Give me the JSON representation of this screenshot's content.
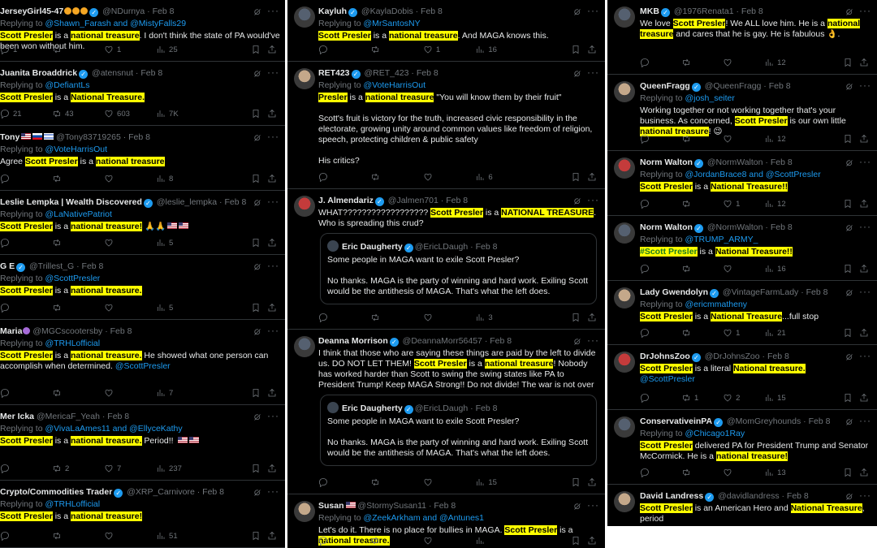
{
  "col1": [
    {
      "name": "JerseyGirl45-47",
      "handle": "@NDurnya",
      "date": "Feb 8",
      "replying": "Replying to",
      "mentions": "@Shawn_Farash and @MistyFalls29",
      "segments": [
        [
          "Scott Presler",
          "hlb"
        ],
        [
          " is a ",
          ""
        ],
        [
          "national treasure",
          "hlb"
        ],
        [
          ". I don't think the state of PA would've been won without him.",
          ""
        ]
      ],
      "stats": [
        "1",
        "",
        "1",
        "25"
      ]
    },
    {
      "name": "Juanita Broaddrick",
      "handle": "@atensnut",
      "date": "Feb 8",
      "replying": "Replying to",
      "mentions": "@DefiantLs",
      "segments": [
        [
          "Scott Presler",
          "hlb"
        ],
        [
          " is a ",
          ""
        ],
        [
          "National Treasure.",
          "hlb"
        ]
      ],
      "stats": [
        "21",
        "43",
        "603",
        "7K"
      ]
    },
    {
      "name": "Tony",
      "handle": "@Tony83719265",
      "date": "Feb 8",
      "replying": "Replying to",
      "mentions": "@VoteHarrisOut",
      "segments": [
        [
          "Agree ",
          ""
        ],
        [
          "Scott Presler",
          "hlb"
        ],
        [
          " is a ",
          ""
        ],
        [
          "national treasure",
          "hlb"
        ]
      ],
      "stats": [
        "",
        "",
        "",
        "8"
      ]
    },
    {
      "name": "Leslie Lempka | Wealth Discovered",
      "handle": "@leslie_lempka",
      "date": "Feb 8",
      "replying": "Replying to",
      "mentions": "@LaNativePatriot",
      "segments": [
        [
          "Scott Presler",
          "hlb"
        ],
        [
          " is a ",
          ""
        ],
        [
          "national treasure!",
          "hlb"
        ],
        [
          " 🙏🙏",
          ""
        ]
      ],
      "stats": [
        "",
        "",
        "",
        "5"
      ]
    },
    {
      "name": "G E",
      "handle": "@Trillest_G",
      "date": "Feb 8",
      "replying": "Replying to",
      "mentions": "@ScottPresler",
      "segments": [
        [
          "Scott Presler",
          "hlb"
        ],
        [
          " is a ",
          ""
        ],
        [
          "national treasure.",
          "hlb"
        ]
      ],
      "stats": [
        "",
        "",
        "",
        "5"
      ]
    },
    {
      "name": "Maria",
      "handle": "@MGCscootersby",
      "date": "Feb 8",
      "replying": "Replying to",
      "mentions": "@TRHLofficial",
      "segments": [
        [
          "Scott Presler",
          "hlb"
        ],
        [
          " is a ",
          ""
        ],
        [
          "national treasure.",
          "hlb"
        ],
        [
          "  He showed what one person can accomplish when determined. ",
          ""
        ],
        [
          "@ScottPresler",
          "mention"
        ]
      ],
      "stats": [
        "",
        "",
        "",
        "7"
      ]
    },
    {
      "name": "Mer Icka",
      "handle": "@MericaF_Yeah",
      "date": "Feb 8",
      "replying": "Replying to",
      "mentions": "@VivaLaAmes11 and @EllyceKathy",
      "segments": [
        [
          "Scott Presler",
          "hlb"
        ],
        [
          " is a ",
          ""
        ],
        [
          "national treasure.",
          "hlb"
        ],
        [
          " Period!! ",
          ""
        ]
      ],
      "stats": [
        "",
        "2",
        "7",
        "237"
      ]
    },
    {
      "name": "Crypto/Commodities Trader",
      "handle": "@XRP_Carnivore",
      "date": "Feb 8",
      "replying": "Replying to",
      "mentions": "@TRHLofficial",
      "segments": [
        [
          "Scott Presler",
          "hlb"
        ],
        [
          " is a ",
          ""
        ],
        [
          "national treasure!",
          "hlb"
        ]
      ],
      "stats": [
        "",
        "",
        "",
        "51"
      ]
    }
  ],
  "col2": [
    {
      "name": "Kayluh",
      "handle": "@KaylaDobis",
      "date": "Feb 8",
      "replying": "Replying to",
      "mentions": "@MrSantosNY",
      "segments": [
        [
          "Scott Presler",
          "hlb"
        ],
        [
          " is a ",
          ""
        ],
        [
          "national treasure",
          "hlb"
        ],
        [
          ". And MAGA knows this.",
          ""
        ]
      ],
      "stats": [
        "",
        "",
        "1",
        "16"
      ]
    },
    {
      "name": "RET423",
      "handle": "@RET_423",
      "date": "Feb 8",
      "replying": "Replying to",
      "mentions": "@VoteHarrisOut",
      "segments": [
        [
          "Presler",
          "hlb"
        ],
        [
          " is a ",
          ""
        ],
        [
          "national treasure",
          "hlb"
        ],
        [
          " \"You will know them by their fruit\"\n\nScott's fruit is victory for the truth, increased civic responsibility in the electorate, growing unity around common values like freedom of religion, speech, protecting children & public safety\n\nHis critics?",
          ""
        ]
      ],
      "stats": [
        "",
        "",
        "",
        "6"
      ]
    },
    {
      "name": "J. Almendariz",
      "handle": "@Jalmen701",
      "date": "Feb 8",
      "replying": "",
      "mentions": "",
      "segments": [
        [
          "WHAT?????????????????? ",
          ""
        ],
        [
          "Scott Presler",
          "hlb"
        ],
        [
          " is a ",
          ""
        ],
        [
          "NATIONAL TREASURE",
          "hlb"
        ],
        [
          ". Who is spreading this crud?",
          ""
        ]
      ],
      "quote": {
        "name": "Eric Daugherty",
        "handle": "@EricLDaugh",
        "date": "Feb 8",
        "text": "Some people in MAGA want to exile Scott Presler?\n\nNo thanks. MAGA is the party of winning and hard work. Exiling Scott would be the antithesis of MAGA. That's what the left does."
      },
      "stats": [
        "",
        "",
        "",
        "3"
      ]
    },
    {
      "name": "Deanna Morrison",
      "handle": "@DeannaMorr56457",
      "date": "Feb 8",
      "replying": "",
      "mentions": "",
      "segments": [
        [
          "I think that those who are saying these things are paid by the left to divide us. DO NOT LET THEM! ",
          ""
        ],
        [
          "Scott Presler",
          "hlb"
        ],
        [
          " is a ",
          ""
        ],
        [
          "national treasure",
          "hlb"
        ],
        [
          "! Nobody has worked harder than Scott to swing the swing states like PA to President Trump! Keep MAGA Strong!! Do not divide! The war is not over",
          ""
        ]
      ],
      "quote": {
        "name": "Eric Daugherty",
        "handle": "@EricLDaugh",
        "date": "Feb 8",
        "text": "Some people in MAGA want to exile Scott Presler?\n\nNo thanks. MAGA is the party of winning and hard work. Exiling Scott would be the antithesis of MAGA. That's what the left does."
      },
      "stats": [
        "",
        "",
        "",
        "15"
      ]
    },
    {
      "name": "Susan",
      "handle": "@StormySusan11",
      "date": "Feb 8",
      "replying": "Replying to",
      "mentions": "@ZeekArkham and @Antunes1",
      "segments": [
        [
          "Let's do it. There is no place for bullies in MAGA. ",
          ""
        ],
        [
          "Scott Presler",
          "hlb"
        ],
        [
          " is a ",
          ""
        ],
        [
          "national treasure.",
          "hlb"
        ]
      ],
      "stats": [
        "",
        "",
        "",
        ""
      ]
    }
  ],
  "col3": [
    {
      "name": "MKB",
      "handle": "@1976Renata1",
      "date": "Feb 8",
      "replying": "",
      "mentions": "",
      "segments": [
        [
          "We love ",
          ""
        ],
        [
          "Scott Presler",
          "hlb"
        ],
        [
          "! We ALL love him. He is a ",
          ""
        ],
        [
          "national treasure",
          "hlb"
        ],
        [
          " and cares that he is gay. He is fabulous 👌.",
          ""
        ]
      ],
      "stats": [
        "",
        "",
        "",
        "12"
      ]
    },
    {
      "name": "QueenFragg",
      "handle": "@QueenFragg",
      "date": "Feb 8",
      "replying": "Replying to",
      "mentions": "@josh_seiter",
      "segments": [
        [
          "Working together or not working together that's your business. As concerned, ",
          ""
        ],
        [
          "Scott Presler",
          "hlb"
        ],
        [
          " is our own little ",
          ""
        ],
        [
          "national treasure",
          "hlb"
        ],
        [
          "! 😉",
          ""
        ]
      ],
      "stats": [
        "",
        "",
        "",
        "12"
      ]
    },
    {
      "name": "Norm Walton",
      "handle": "@NormWalton",
      "date": "Feb 8",
      "replying": "Replying to",
      "mentions": "@JordanBrace8 and @ScottPresler",
      "segments": [
        [
          "Scott Presler",
          "hlb"
        ],
        [
          " is a ",
          ""
        ],
        [
          "National Treasure!!",
          "hlb"
        ]
      ],
      "stats": [
        "",
        "",
        "1",
        "12"
      ]
    },
    {
      "name": "Norm Walton",
      "handle": "@NormWalton",
      "date": "Feb 8",
      "replying": "Replying to",
      "mentions": "@TRUMP_ARMY_",
      "segments": [
        [
          "#Scott Presler",
          "hlbm"
        ],
        [
          " is a ",
          ""
        ],
        [
          "National Treasure!!",
          "hlb"
        ]
      ],
      "stats": [
        "",
        "",
        "",
        "16"
      ]
    },
    {
      "name": "Lady Gwendolyn",
      "handle": "@VintageFarmLady",
      "date": "Feb 8",
      "replying": "Replying to",
      "mentions": "@ericmmatheny",
      "segments": [
        [
          "Scott Presler",
          "hlb"
        ],
        [
          " is a ",
          ""
        ],
        [
          "National Treasure",
          "hlb"
        ],
        [
          "...full stop",
          ""
        ]
      ],
      "stats": [
        "",
        "",
        "1",
        "21"
      ]
    },
    {
      "name": "DrJohnsZoo",
      "handle": "@DrJohnsZoo",
      "date": "Feb 8",
      "replying": "",
      "mentions": "",
      "segments": [
        [
          "Scott Presler",
          "hlb"
        ],
        [
          " is a literal ",
          ""
        ],
        [
          "National treasure.",
          "hlb"
        ],
        [
          "\n",
          ""
        ],
        [
          "@ScottPresler",
          "mention"
        ]
      ],
      "stats": [
        "",
        "1",
        "2",
        "15"
      ]
    },
    {
      "name": "ConservativeinPA",
      "handle": "@MomGreyhounds",
      "date": "Feb 8",
      "replying": "Replying to",
      "mentions": "@Chicago1Ray",
      "segments": [
        [
          "Scott Presler",
          "hlb"
        ],
        [
          " delivered PA for President Trump and Senator McCormick. He is a ",
          ""
        ],
        [
          "national treasure!",
          "hlb"
        ]
      ],
      "stats": [
        "",
        "",
        "",
        "13"
      ]
    },
    {
      "name": "David Landress",
      "handle": "@davidlandress",
      "date": "Feb 8",
      "replying": "",
      "mentions": "",
      "segments": [
        [
          "Scott Presler",
          "hlb"
        ],
        [
          " is an American Hero and ",
          ""
        ],
        [
          "National Treasure",
          "hlb"
        ],
        [
          ", period",
          ""
        ]
      ],
      "stats": [
        "",
        "",
        "",
        ""
      ]
    }
  ],
  "colors": {
    "bg": "#000000",
    "text": "#e7e9ea",
    "muted": "#71767b",
    "link": "#1d9bf0",
    "highlight": "#ffff00",
    "border": "#2f3336"
  },
  "icons": [
    "reply-icon",
    "retweet-icon",
    "like-icon",
    "views-icon",
    "bookmark-icon",
    "share-icon",
    "grok-icon",
    "more-icon",
    "verified-icon"
  ]
}
